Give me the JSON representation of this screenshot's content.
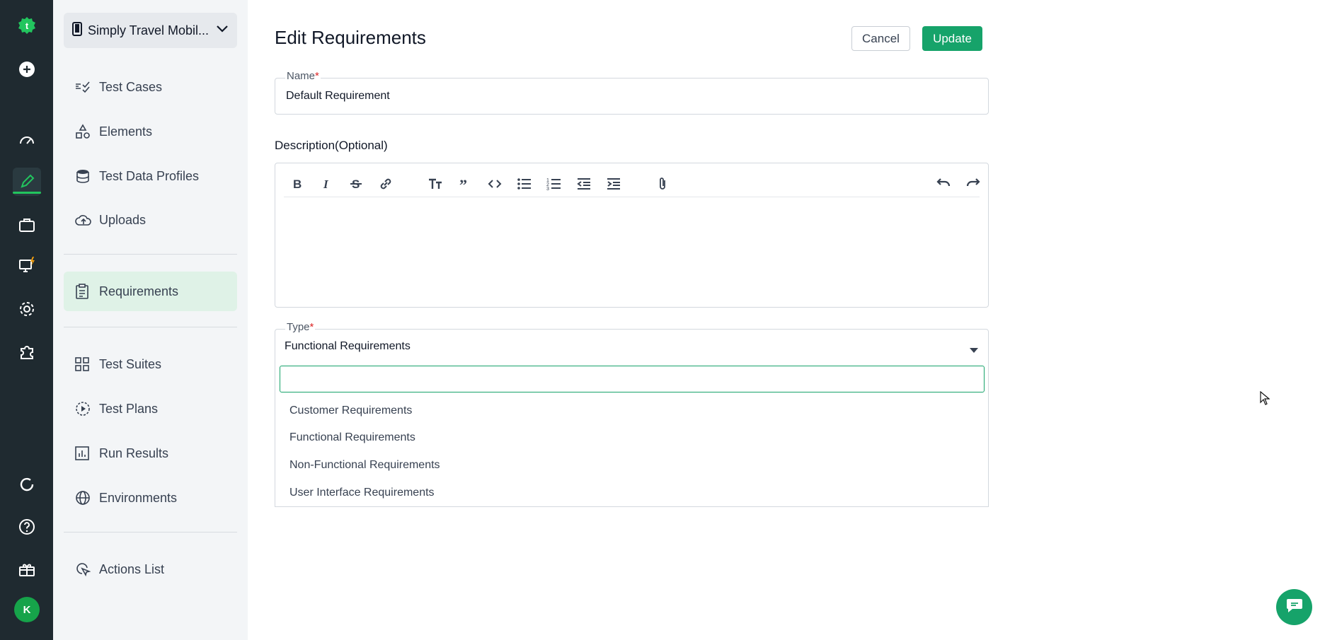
{
  "project": {
    "name": "Simply Travel Mobil..."
  },
  "nav": {
    "test_cases": "Test Cases",
    "elements": "Elements",
    "test_data_profiles": "Test Data Profiles",
    "uploads": "Uploads",
    "requirements": "Requirements",
    "test_suites": "Test Suites",
    "test_plans": "Test Plans",
    "run_results": "Run Results",
    "environments": "Environments",
    "actions_list": "Actions List"
  },
  "user": {
    "initial": "K"
  },
  "page": {
    "title": "Edit Requirements"
  },
  "actions": {
    "cancel": "Cancel",
    "update": "Update"
  },
  "form": {
    "name_label": "Name",
    "required_mark": "*",
    "name_value": "Default Requirement",
    "description_label": "Description(Optional)",
    "type_label": "Type",
    "type_value": "Functional Requirements",
    "search_placeholder": "",
    "type_options": [
      "Customer Requirements",
      "Functional Requirements",
      "Non-Functional Requirements",
      "User Interface Requirements"
    ]
  },
  "colors": {
    "brand_green": "#16a36a",
    "rail_bg": "#1f2a30",
    "active_nav_bg": "#dff2e7"
  }
}
